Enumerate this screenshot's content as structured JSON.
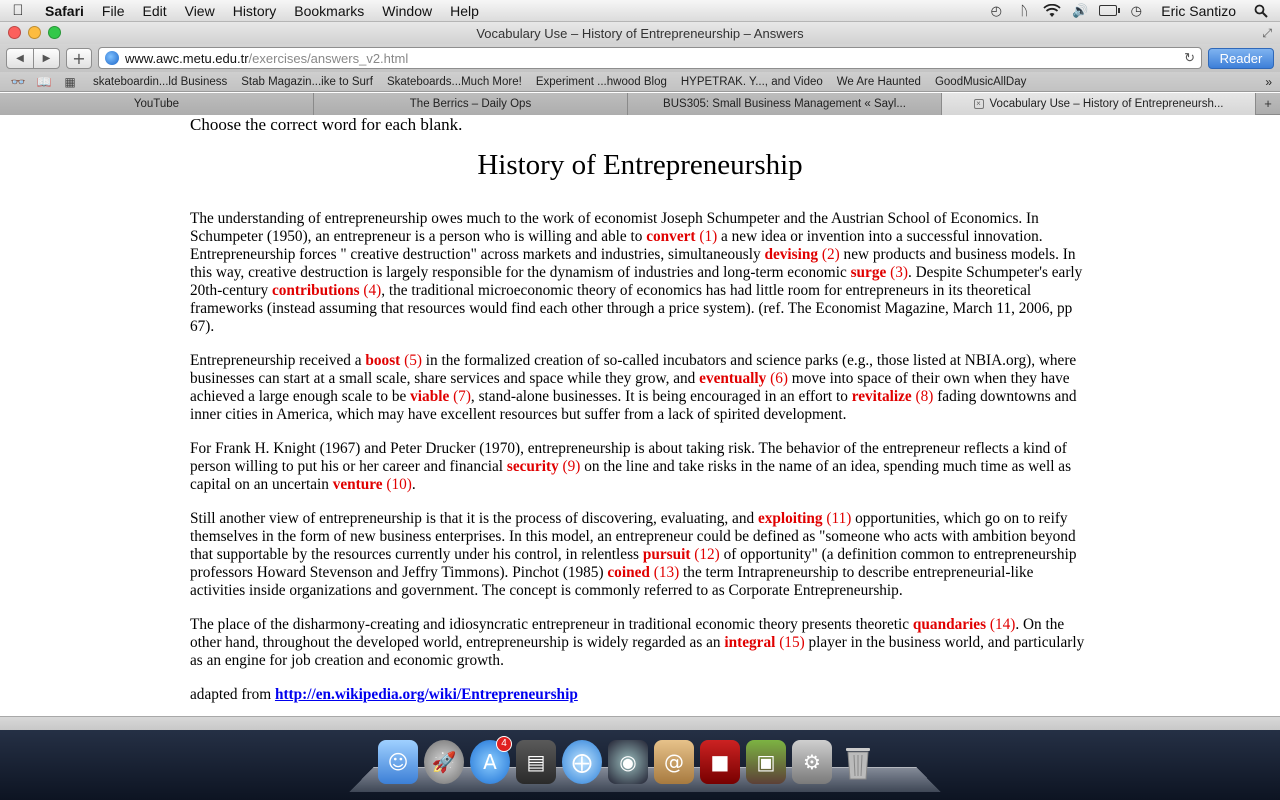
{
  "menubar": {
    "app_name": "Safari",
    "items": [
      "File",
      "Edit",
      "View",
      "History",
      "Bookmarks",
      "Window",
      "Help"
    ],
    "user": "Eric Santizo"
  },
  "window": {
    "title": "Vocabulary Use – History of Entrepreneurship – Answers"
  },
  "toolbar": {
    "url_host": "www.awc.metu.edu.tr",
    "url_path": "/exercises/answers_v2.html",
    "reader_label": "Reader"
  },
  "bookmarks": [
    "skateboardin...ld Business",
    "Stab Magazin...ike to Surf",
    "Skateboards...Much More!",
    "Experiment ...hwood Blog",
    "HYPETRAK. Y..., and Video",
    "We Are Haunted",
    "GoodMusicAllDay"
  ],
  "tabs": [
    {
      "label": "YouTube"
    },
    {
      "label": "The Berrics – Daily Ops"
    },
    {
      "label": "BUS305: Small Business Management « Sayl..."
    },
    {
      "label": "Vocabulary Use – History of Entrepreneursh..."
    }
  ],
  "page": {
    "instructions": "Choose the correct word for each blank.",
    "title": "History of Entrepreneurship",
    "p1": [
      "The understanding of entrepreneurship owes much to the work of economist Joseph Schumpeter and the Austrian School of Economics. In Schumpeter (1950), an entrepreneur is a person who is willing and able to ",
      " a new idea or invention into a successful innovation. Entrepreneurship forces \" creative destruction\" across markets and industries, simultaneously ",
      " new products and business models. In this way, creative destruction is largely responsible for the dynamism of industries and long-term economic ",
      ". Despite Schumpeter's early 20th-century ",
      ", the traditional microeconomic theory of economics has had little room for entrepreneurs in its theoretical frameworks (instead assuming that resources would find each other through a price system). (ref. The Economist Magazine, March 11, 2006, pp 67)."
    ],
    "p2": [
      "Entrepreneurship received a ",
      " in the formalized creation of so-called incubators and science parks (e.g., those listed at NBIA.org), where businesses can start at a small scale, share services and space while they grow, and ",
      " move into space of their own when they have achieved a large enough scale to be ",
      ", stand-alone businesses. It is being encouraged in an effort to ",
      " fading downtowns and inner cities in America, which may have excellent resources but suffer from a lack of spirited development."
    ],
    "p3": [
      "For Frank H. Knight (1967) and Peter Drucker (1970), entrepreneurship is about taking risk. The behavior of the entrepreneur reflects a kind of person willing to put his or her career and financial ",
      " on the line and take risks in the name of an idea, spending much time as well as capital on an uncertain ",
      "."
    ],
    "p4": [
      "Still another view of entrepreneurship is that it is the process of discovering, evaluating, and ",
      " opportunities, which go on to reify themselves in the form of new business enterprises. In this model, an entrepreneur could be defined as \"someone who acts with ambition beyond that supportable by the resources currently under his control, in relentless ",
      " of opportunity\" (a definition common to entrepreneurship professors Howard Stevenson and Jeffry Timmons). Pinchot (1985) ",
      " the term Intrapreneurship to describe entrepreneurial-like activities inside organizations and government. The concept is commonly referred to as Corporate Entrepreneurship."
    ],
    "p5": [
      "The place of the disharmony-creating and idiosyncratic entrepreneur in traditional economic theory presents theoretic ",
      ". On the other hand, throughout the developed world, entrepreneurship is widely regarded as an ",
      " player in the business world, and particularly as an engine for job creation and economic growth."
    ],
    "answers": [
      {
        "word": "convert",
        "num": "(1)"
      },
      {
        "word": "devising",
        "num": "(2)"
      },
      {
        "word": "surge",
        "num": "(3)"
      },
      {
        "word": "contributions",
        "num": "(4)"
      },
      {
        "word": "boost",
        "num": "(5)"
      },
      {
        "word": "eventually",
        "num": "(6)"
      },
      {
        "word": "viable",
        "num": "(7)"
      },
      {
        "word": "revitalize",
        "num": "(8)"
      },
      {
        "word": "security",
        "num": "(9)"
      },
      {
        "word": "venture",
        "num": "(10)"
      },
      {
        "word": "exploiting",
        "num": "(11)"
      },
      {
        "word": "pursuit",
        "num": "(12)"
      },
      {
        "word": "coined",
        "num": "(13)"
      },
      {
        "word": "quandaries",
        "num": "(14)"
      },
      {
        "word": "integral",
        "num": "(15)"
      }
    ],
    "source_prefix": "adapted from ",
    "source_link": "http://en.wikipedia.org/wiki/Entrepreneurship"
  },
  "dock": {
    "app_store_badge": "4"
  },
  "colors": {
    "answer": "#e00000",
    "link": "#0000ee",
    "reader_button": "#3d7fd8"
  }
}
